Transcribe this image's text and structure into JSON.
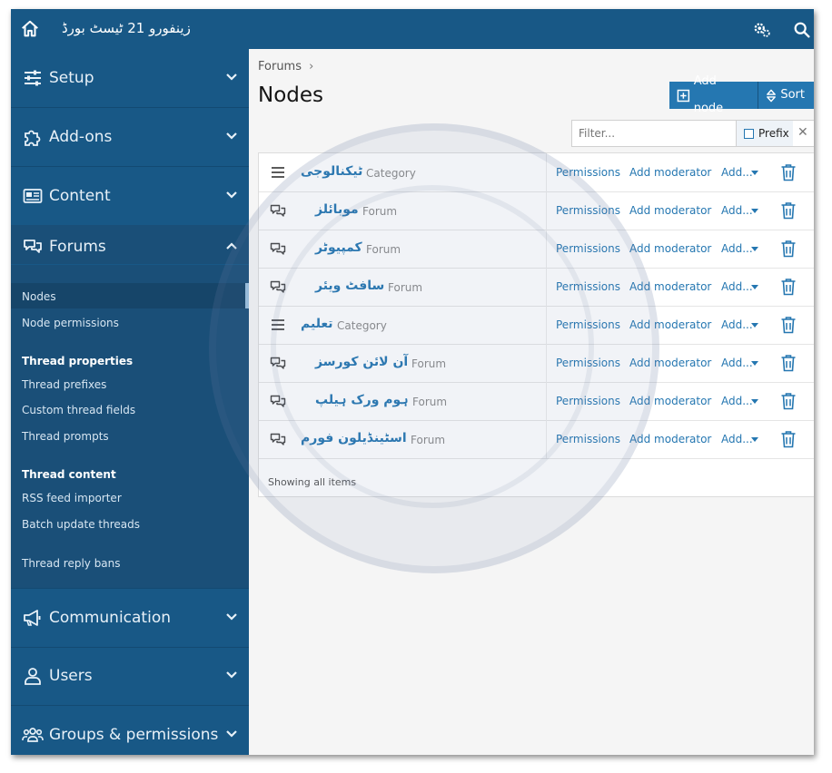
{
  "topbar": {
    "title": "زینفورو 21 ٹیسٹ بورڈ"
  },
  "sidebar": {
    "sections_top": [
      {
        "label": "Setup",
        "icon": "sliders-icon"
      },
      {
        "label": "Add-ons",
        "icon": "puzzle-icon"
      },
      {
        "label": "Content",
        "icon": "newspaper-icon"
      }
    ],
    "forums": {
      "label": "Forums",
      "links": [
        "Nodes",
        "Node permissions"
      ],
      "thread_properties_heading": "Thread properties",
      "thread_properties": [
        "Thread prefixes",
        "Custom thread fields",
        "Thread prompts"
      ],
      "thread_content_heading": "Thread content",
      "thread_content": [
        "RSS feed importer",
        "Batch update threads"
      ],
      "extra": "Thread reply bans"
    },
    "sections_bottom": [
      {
        "label": "Communication",
        "icon": "megaphone-icon"
      },
      {
        "label": "Users",
        "icon": "user-icon"
      },
      {
        "label": "Groups & permissions",
        "icon": "users-icon"
      }
    ]
  },
  "main": {
    "breadcrumb": "Forums",
    "title": "Nodes",
    "buttons": {
      "add_node": "Add node",
      "sort": "Sort"
    },
    "filter": {
      "placeholder": "Filter...",
      "prefix_label": "Prefix"
    },
    "rows": [
      {
        "name": "ٹیکنالوجی",
        "type": "Category",
        "kind": "category",
        "indent": 0
      },
      {
        "name": "موبائلز",
        "type": "Forum",
        "kind": "forum",
        "indent": 1
      },
      {
        "name": "کمپیوٹر",
        "type": "Forum",
        "kind": "forum",
        "indent": 1
      },
      {
        "name": "سافٹ ویئر",
        "type": "Forum",
        "kind": "forum",
        "indent": 1
      },
      {
        "name": "تعلیم",
        "type": "Category",
        "kind": "category",
        "indent": 0
      },
      {
        "name": "آن لائن کورسز",
        "type": "Forum",
        "kind": "forum",
        "indent": 1
      },
      {
        "name": "ہوم ورک ہیلپ",
        "type": "Forum",
        "kind": "forum",
        "indent": 1
      },
      {
        "name": "اسٹینڈیلون فورم",
        "type": "Forum",
        "kind": "forum",
        "indent": 0
      }
    ],
    "row_actions": {
      "permissions": "Permissions",
      "add_moderator": "Add moderator",
      "add": "Add..."
    },
    "footer": "Showing all items"
  },
  "colors": {
    "nav": "#185886",
    "accent": "#2577b1"
  }
}
